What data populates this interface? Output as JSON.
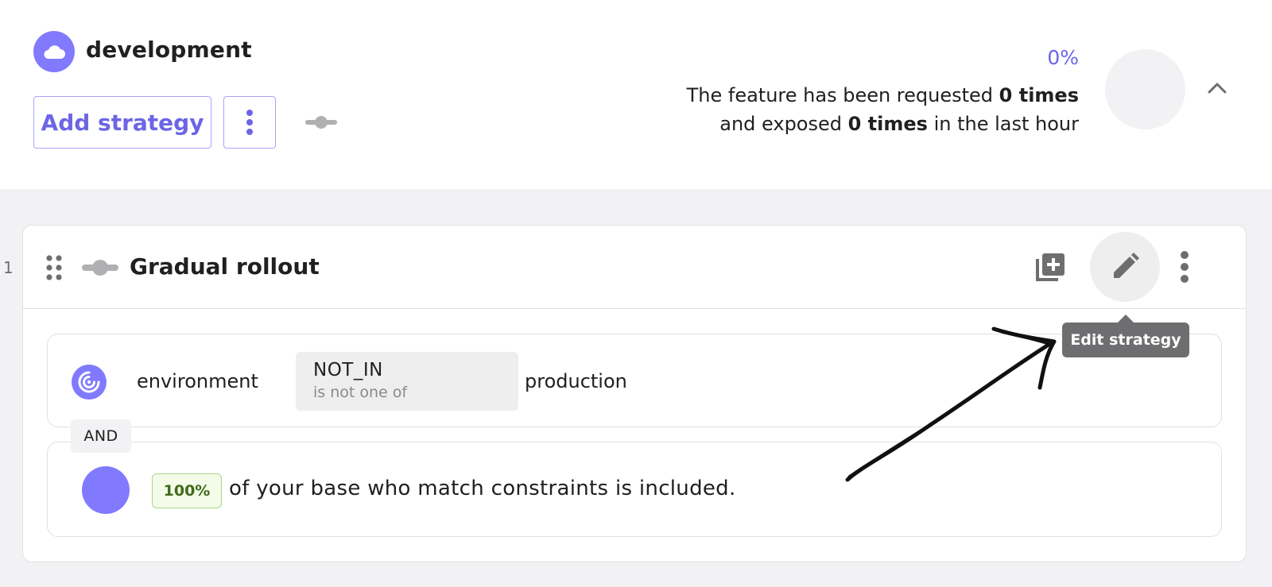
{
  "environment": {
    "name": "development",
    "add_strategy_label": "Add strategy",
    "percentage": "0%",
    "stats": {
      "line1_prefix": "The feature has been requested ",
      "requested": "0 times",
      "line2_prefix": "and exposed ",
      "exposed": "0 times",
      "line2_suffix": " in the last hour"
    },
    "icon": "cloud-icon"
  },
  "strategy": {
    "index": "1",
    "title": "Gradual rollout",
    "tooltip": "Edit strategy",
    "constraint": {
      "context_name": "environment",
      "operator": "NOT_IN",
      "operator_description": "is not one of",
      "value": "production"
    },
    "and_label": "AND",
    "rollout": {
      "percentage": "100%",
      "text": "of your base who match constraints is included."
    }
  },
  "colors": {
    "accent": "#817afe",
    "accent_text": "#6c65e5",
    "badge_bg": "#f4fbe9",
    "badge_text": "#3f6b18"
  }
}
